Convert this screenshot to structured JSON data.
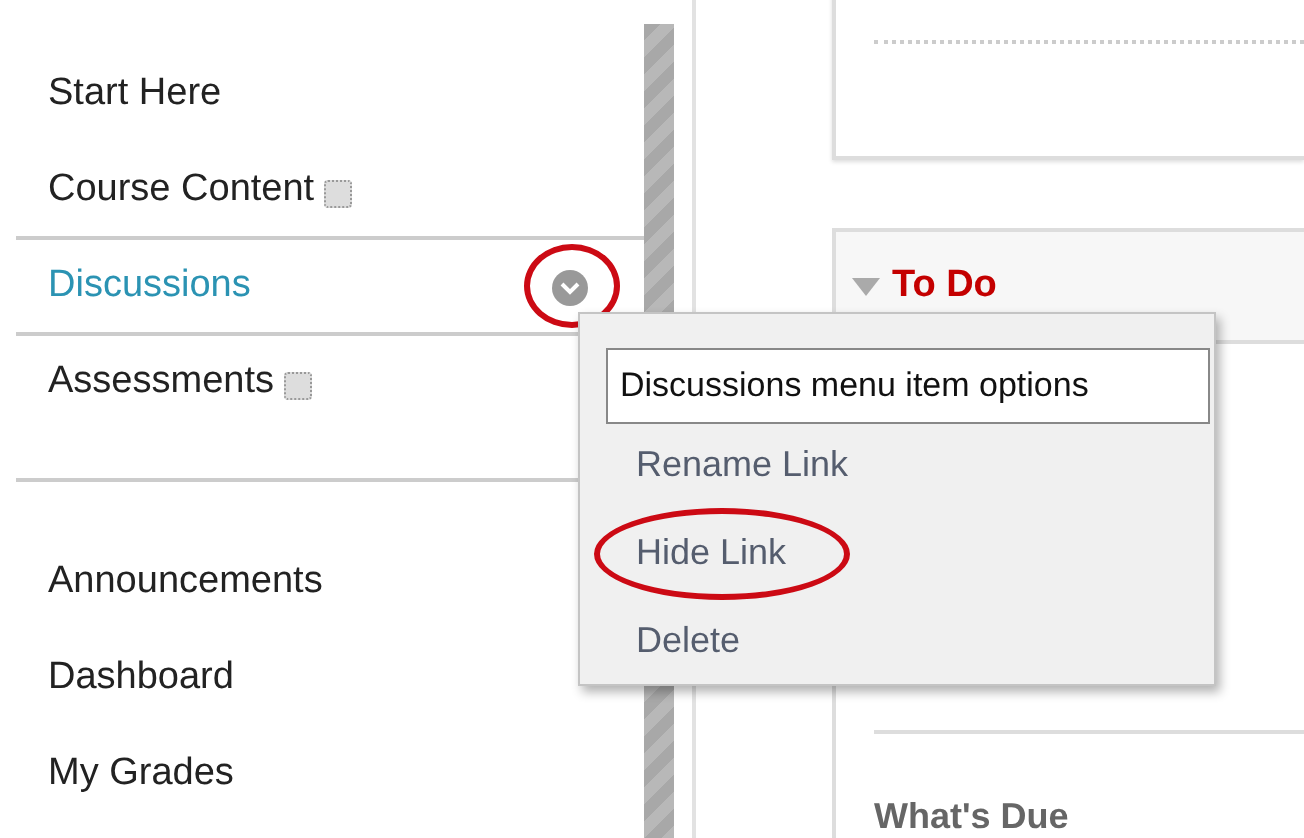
{
  "sidebar": {
    "groups": [
      {
        "items": [
          {
            "label": "Start Here",
            "selected": false,
            "has_icon": false,
            "circled": false
          },
          {
            "label": "Course Content",
            "selected": false,
            "has_icon": true,
            "circled": false
          },
          {
            "label": "Discussions",
            "selected": true,
            "has_icon": false,
            "circled": true
          },
          {
            "label": "Assessments",
            "selected": false,
            "has_icon": true,
            "circled": false
          }
        ]
      },
      {
        "items": [
          {
            "label": "Announcements",
            "selected": false,
            "has_icon": false,
            "circled": false
          },
          {
            "label": "Dashboard",
            "selected": false,
            "has_icon": false,
            "circled": false
          },
          {
            "label": "My Grades",
            "selected": false,
            "has_icon": false,
            "circled": false
          }
        ]
      }
    ]
  },
  "context_menu": {
    "title": "Discussions menu item options",
    "items": [
      {
        "label": "Rename Link",
        "circled": false
      },
      {
        "label": "Hide Link",
        "circled": true
      },
      {
        "label": "Delete",
        "circled": false
      }
    ]
  },
  "panels": [
    {
      "title": "To Do",
      "expanded": true,
      "section": "What's Due"
    }
  ]
}
